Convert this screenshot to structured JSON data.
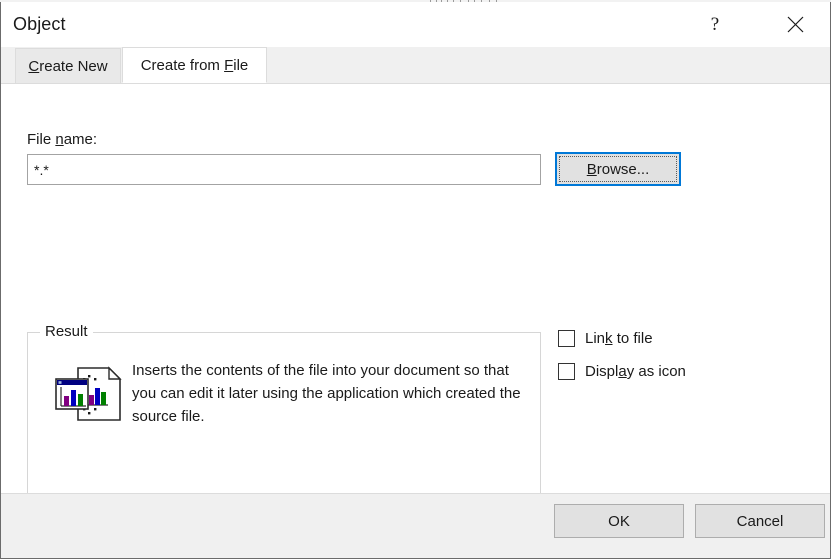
{
  "window": {
    "title": "Object",
    "help_icon": "question-mark-icon",
    "close_icon": "close-x-icon"
  },
  "tabs": [
    {
      "label": "Create New",
      "accel": "C",
      "active": false
    },
    {
      "label": "Create from File",
      "accel": "F",
      "active": true
    }
  ],
  "form": {
    "filename_label": "File name:",
    "filename_accel": "n",
    "filename_value": "*.*",
    "filename_placeholder": "",
    "browse_label": "Browse...",
    "browse_accel": "B",
    "browse_focused": "true"
  },
  "options": [
    {
      "label": "Link to file",
      "accel": "k",
      "checked": false,
      "name": "link-to-file"
    },
    {
      "label": "Display as icon",
      "accel": "a",
      "checked": false,
      "name": "display-as-icon"
    }
  ],
  "result": {
    "legend": "Result",
    "description": "Inserts the contents of the file into your document so that you can edit it later using the application which created the source file.",
    "icon": "document-with-chart-icon"
  },
  "footer": {
    "ok_label": "OK",
    "cancel_label": "Cancel"
  },
  "colors": {
    "accent": "#0078d7",
    "dialog_bg": "#ffffff",
    "chrome_bg": "#f0f0f0",
    "button_face": "#e1e1e1",
    "text": "#1a1a1a",
    "icon_titlebar": "#000080",
    "icon_bar_purple": "#800080",
    "icon_bar_blue": "#0000c0",
    "icon_bar_green": "#008000"
  }
}
